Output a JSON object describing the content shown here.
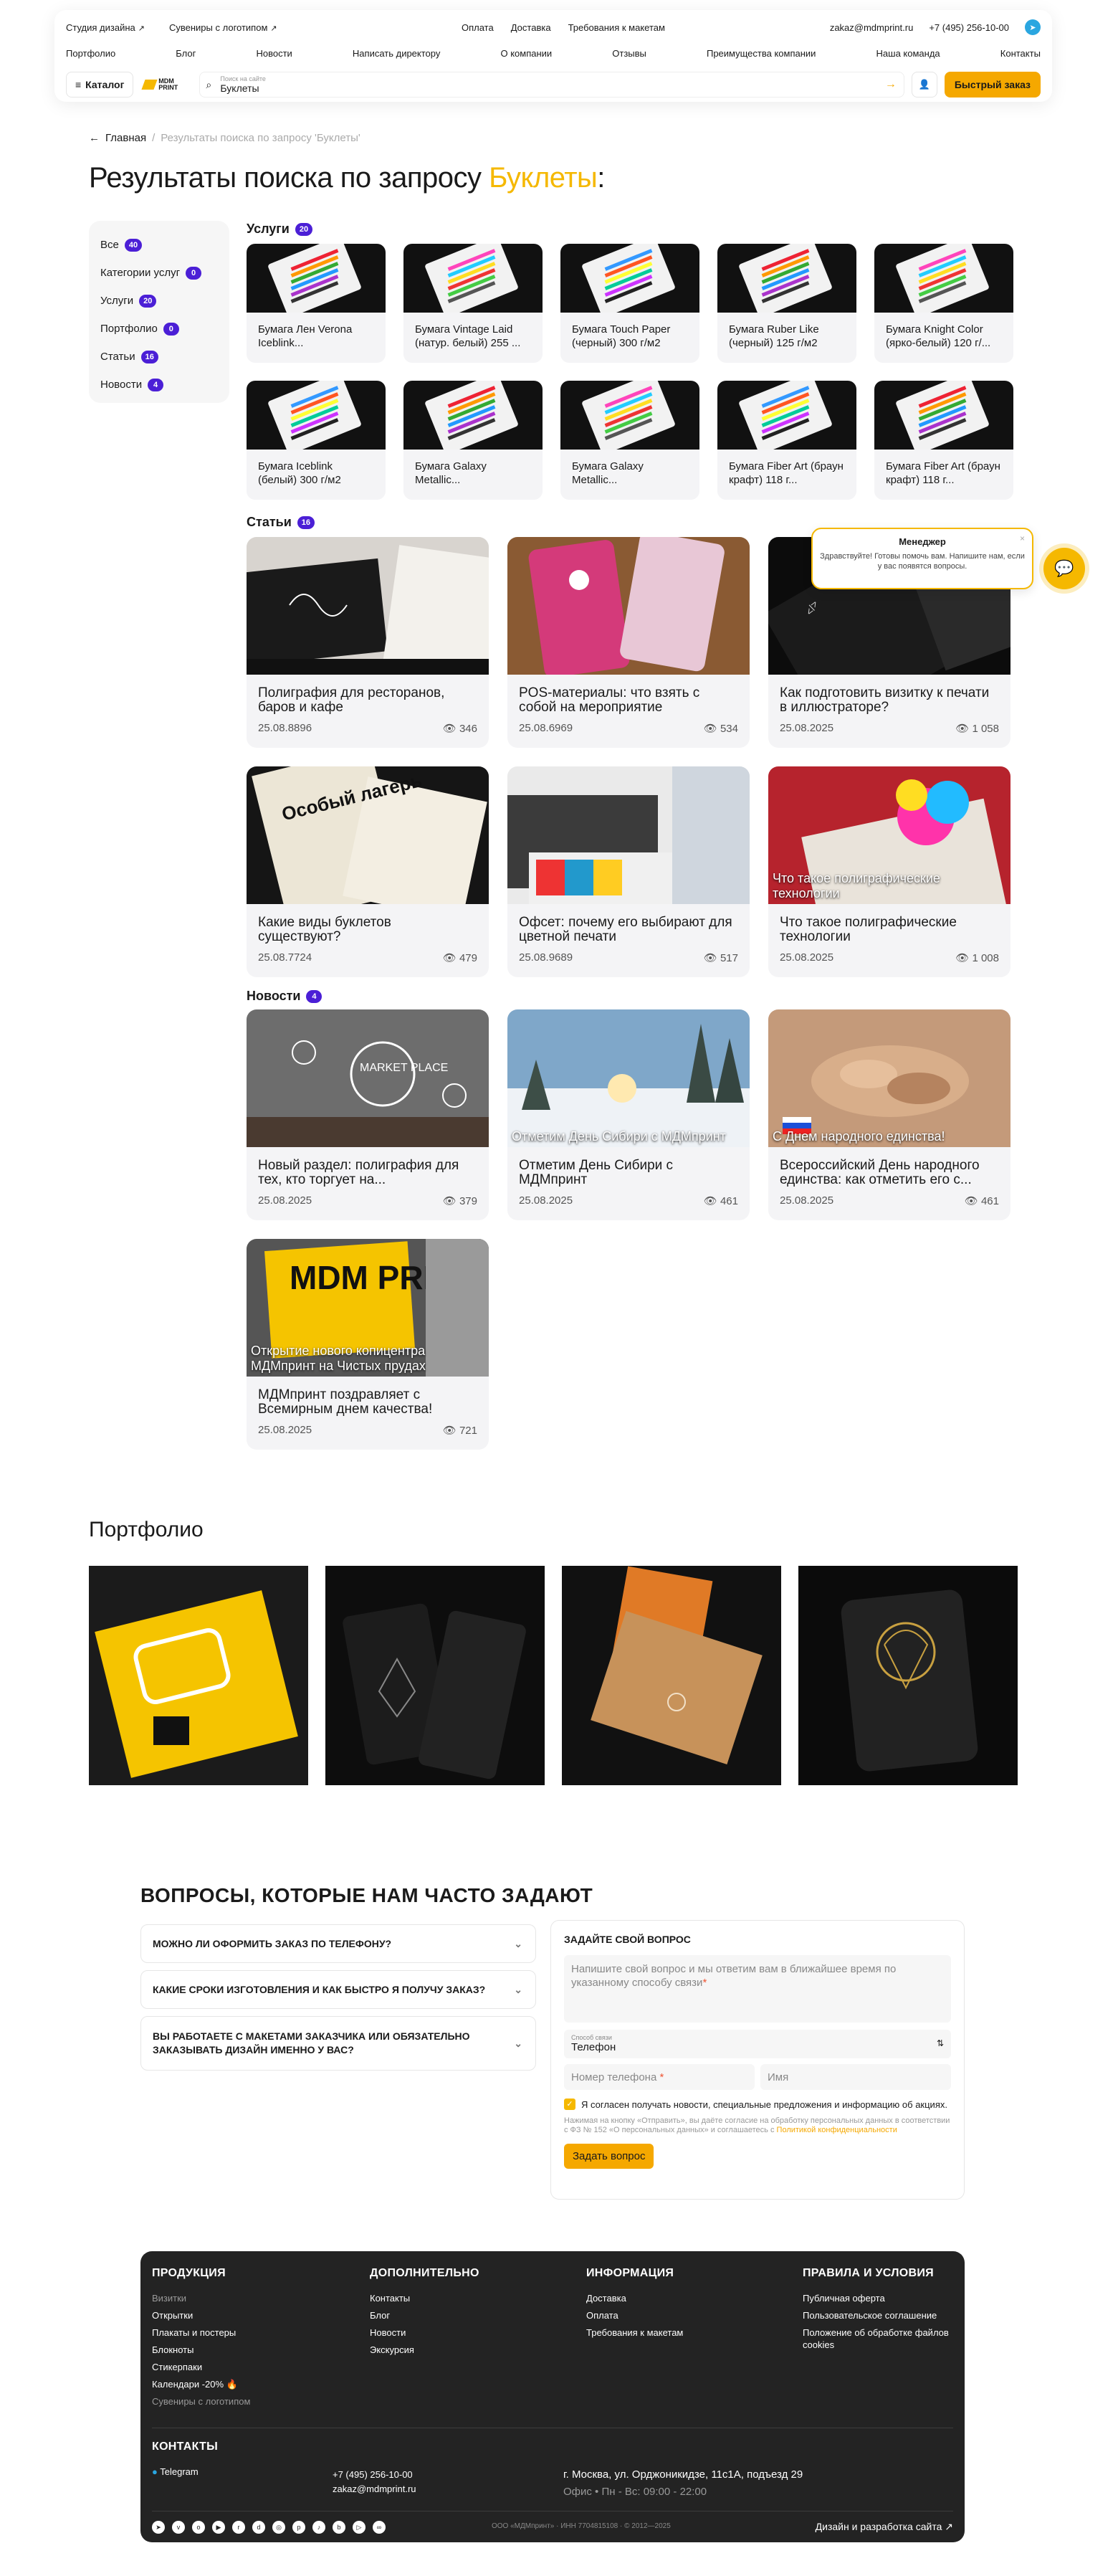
{
  "top": {
    "links": [
      "Студия дизайна",
      "Сувениры с логотипом"
    ],
    "center": [
      "Оплата",
      "Доставка",
      "Требования к макетам"
    ],
    "email": "zakaz@mdmprint.ru",
    "phone": "+7 (495) 256-10-00"
  },
  "nav": [
    "Портфолио",
    "Блог",
    "Новости",
    "Написать директору",
    "О компании",
    "Отзывы",
    "Преимущества компании",
    "Наша команда",
    "Контакты"
  ],
  "catalog_label": "Каталог",
  "logo_text": "MDM PRINT",
  "search": {
    "placeholder": "Поиск на сайте",
    "value": "Буклеты"
  },
  "quick_order": "Быстрый заказ",
  "breadcrumb": {
    "home": "Главная",
    "sep": "/",
    "current": "Результаты поиска по запросу 'Буклеты'"
  },
  "title": {
    "prefix": "Результаты поиска по запросу ",
    "query": "Буклеты",
    "suffix": ":"
  },
  "sidebar": [
    {
      "label": "Все",
      "count": "40"
    },
    {
      "label": "Категории услуг",
      "count": "0"
    },
    {
      "label": "Услуги",
      "count": "20"
    },
    {
      "label": "Портфолио",
      "count": "0"
    },
    {
      "label": "Статьи",
      "count": "16"
    },
    {
      "label": "Новости",
      "count": "4"
    }
  ],
  "services": {
    "title": "Услуги",
    "count": "20",
    "items": [
      "Бумага Лен Verona Iceblink...",
      "Бумага Vintage Laid (натур. белый) 255 ...",
      "Бумага Touch Paper (черный) 300 г/м2",
      "Бумага Ruber Like (черный) 125 г/м2",
      "Бумага Knight Color (ярко-белый) 120 г/...",
      "Бумага Iceblink (белый) 300 г/м2",
      "Бумага Galaxy Metallic...",
      "Бумага Galaxy Metallic...",
      "Бумага Fiber Art (браун крафт) 118 г...",
      "Бумага Fiber Art (браун крафт) 118 г..."
    ]
  },
  "articles": {
    "title": "Статьи",
    "count": "16",
    "items": [
      {
        "title": "Полиграфия для ресторанов, баров и кафе",
        "date": "25.08.8896",
        "views": "346",
        "overlay": ""
      },
      {
        "title": "POS-материалы: что взять с собой на мероприятие",
        "date": "25.08.6969",
        "views": "534",
        "overlay": ""
      },
      {
        "title": "Как подготовить визитку к печати в иллюстраторе?",
        "date": "25.08.2025",
        "views": "1 058",
        "overlay": ""
      },
      {
        "title": "Какие виды буклетов существуют?",
        "date": "25.08.7724",
        "views": "479",
        "overlay": ""
      },
      {
        "title": "Офсет: почему его выбирают для цветной печати",
        "date": "25.08.9689",
        "views": "517",
        "overlay": ""
      },
      {
        "title": "Что такое полиграфические технологии",
        "date": "25.08.2025",
        "views": "1 008",
        "overlay": "Что такое полиграфические технологии"
      }
    ]
  },
  "news": {
    "title": "Новости",
    "count": "4",
    "items": [
      {
        "title": "Новый раздел: полиграфия для тех, кто торгует на...",
        "date": "25.08.2025",
        "views": "379",
        "overlay": ""
      },
      {
        "title": "Отметим День Сибири с МДМпринт",
        "date": "25.08.2025",
        "views": "461",
        "overlay": "Отметим День Сибири с МДМпринт"
      },
      {
        "title": "Всероссийский День народного единства: как отметить его с...",
        "date": "25.08.2025",
        "views": "461",
        "overlay": "С Днем народного единства!"
      },
      {
        "title": "МДМпринт поздравляет с Всемирным днем качества!",
        "date": "25.08.2025",
        "views": "721",
        "overlay": "Открытие нового копицентра МДМпринт на Чистых прудах"
      }
    ]
  },
  "image_texts": {
    "market": "MARKET PLACE",
    "mdm": "MDM PRINT",
    "poster": "Особый лагерь"
  },
  "portfolio_title": "Портфолио",
  "faq": {
    "title": "Вопросы, которые нам часто задают",
    "items": [
      "Можно ли оформить заказ по телефону?",
      "Какие сроки изготовления и как быстро я получу заказ?",
      "Вы работаете с макетами заказчика или обязательно заказывать дизайн именно у вас?"
    ]
  },
  "form": {
    "title": "Задайте свой вопрос",
    "message_ph": "Напишите свой вопрос и мы ответим вам в ближайшее время по указанному способу связи",
    "method_label": "Способ связи",
    "method": "Телефон",
    "phone_ph": "Номер телефона",
    "name_ph": "Имя",
    "consent": "Я согласен получать новости, специальные предложения и информацию об акциях.",
    "note": "Нажимая на кнопку «Отправить», вы даёте согласие на обработку персональных данных в соответствии с ФЗ № 152 «О персональных данных» и соглашаетесь с",
    "note_link": "Политикой конфиденциальности",
    "submit": "Задать вопрос"
  },
  "manager": {
    "title": "Менеджер",
    "text": "Здравствуйте! Готовы помочь вам. Напишите нам, если у вас появятся вопросы."
  },
  "footer": {
    "products": {
      "title": "Продукция",
      "items": [
        "Визитки",
        "Открытки",
        "Плакаты и постеры",
        "Блокноты",
        "Стикерпаки",
        "Календари -20% 🔥",
        "Сувениры с логотипом"
      ]
    },
    "extra": {
      "title": "Дополнительно",
      "items": [
        "Контакты",
        "Блог",
        "Новости",
        "Экскурсия"
      ]
    },
    "info": {
      "title": "Информация",
      "items": [
        "Доставка",
        "Оплата",
        "Требования к макетам"
      ]
    },
    "rules": {
      "title": "Правила и условия",
      "items": [
        "Публичная оферта",
        "Пользовательское соглашение",
        "Положение об обработке файлов cookies"
      ]
    },
    "contacts": {
      "title": "Контакты",
      "telegram": "Telegram",
      "phone": "+7 (495) 256-10-00",
      "email": "zakaz@mdmprint.ru",
      "address": "г. Москва, ул. Орджоникидзе, 11с1А, подъезд 29",
      "hours": "Офис • Пн - Вс: 09:00 - 22:00"
    },
    "legal": "ООО «МДМпринт» · ИНН 7704815108 · © 2012—2025",
    "dev": "Дизайн и разработка сайта"
  }
}
